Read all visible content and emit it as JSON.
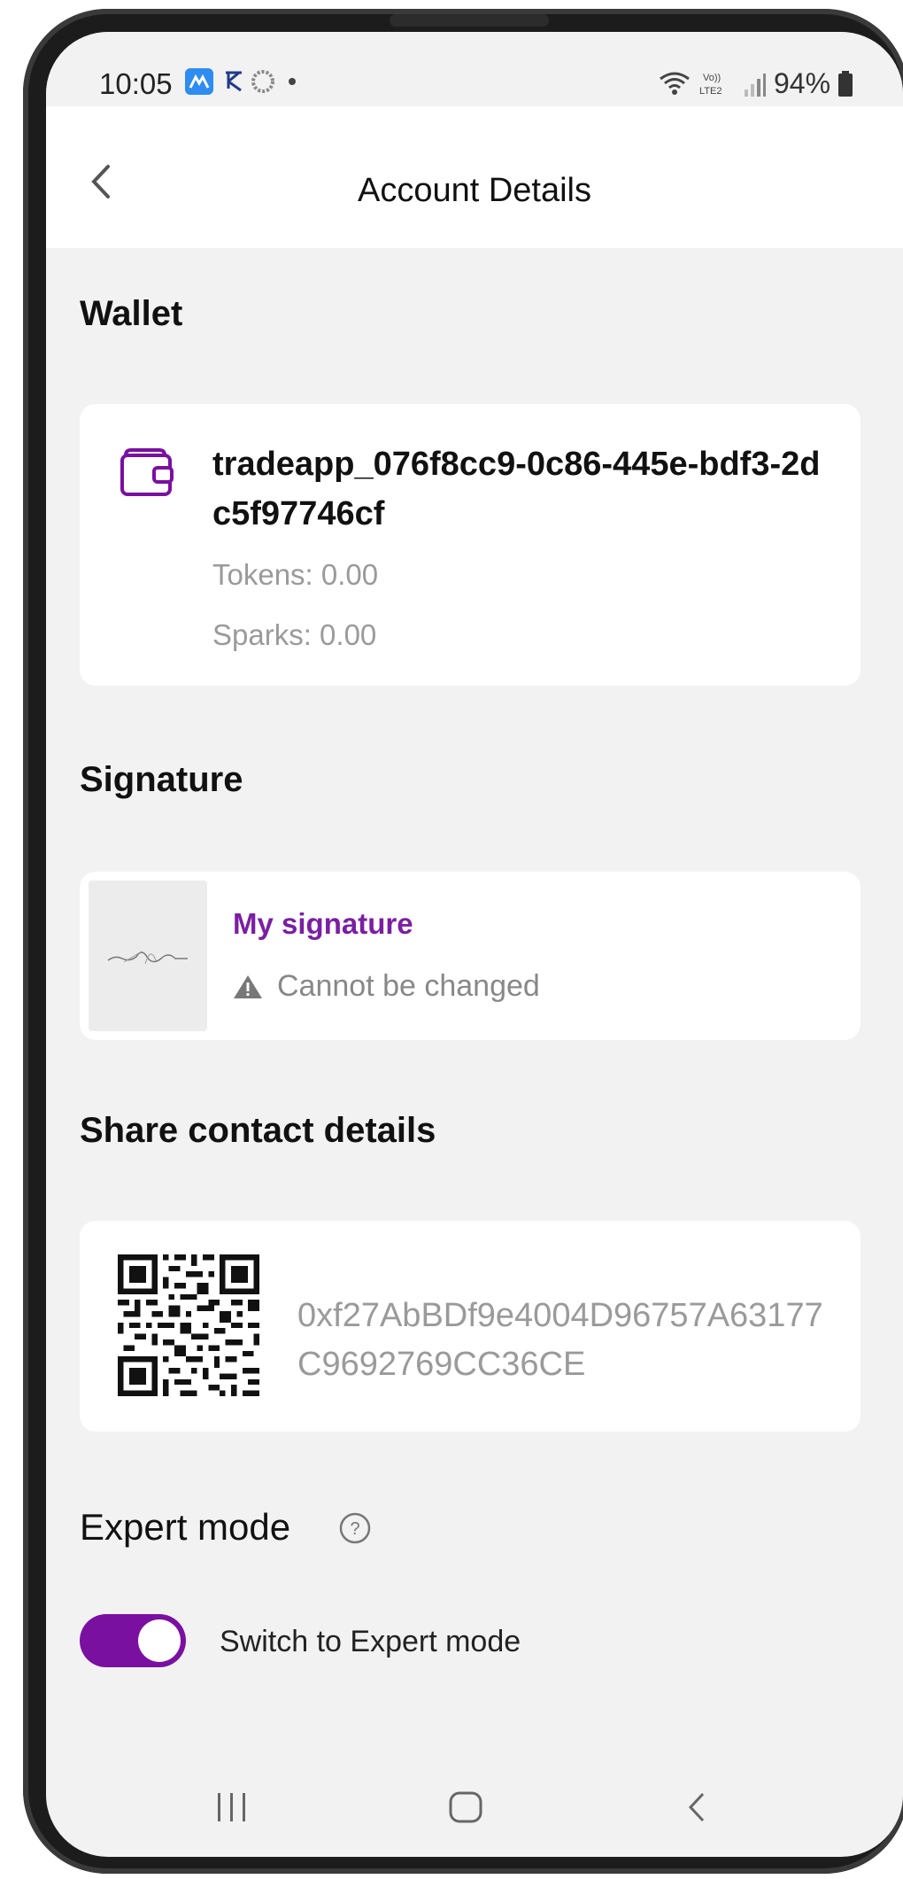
{
  "status_bar": {
    "time": "10:05",
    "battery": "94%"
  },
  "header": {
    "title": "Account Details"
  },
  "wallet": {
    "section_title": "Wallet",
    "name": "tradeapp_076f8cc9-0c86-445e-bdf3-2dc5f97746cf",
    "tokens": "Tokens: 0.00",
    "sparks": "Sparks: 0.00"
  },
  "signature": {
    "section_title": "Signature",
    "label": "My signature",
    "warning": "Cannot be changed"
  },
  "share": {
    "section_title": "Share contact details",
    "address": "0xf27AbBDf9e4004D96757A63177C9692769CC36CE"
  },
  "expert": {
    "section_title": "Expert mode",
    "toggle_label": "Switch to Expert mode",
    "toggle_on": true
  },
  "colors": {
    "accent": "#7a10a0",
    "background": "#f2f2f2"
  }
}
